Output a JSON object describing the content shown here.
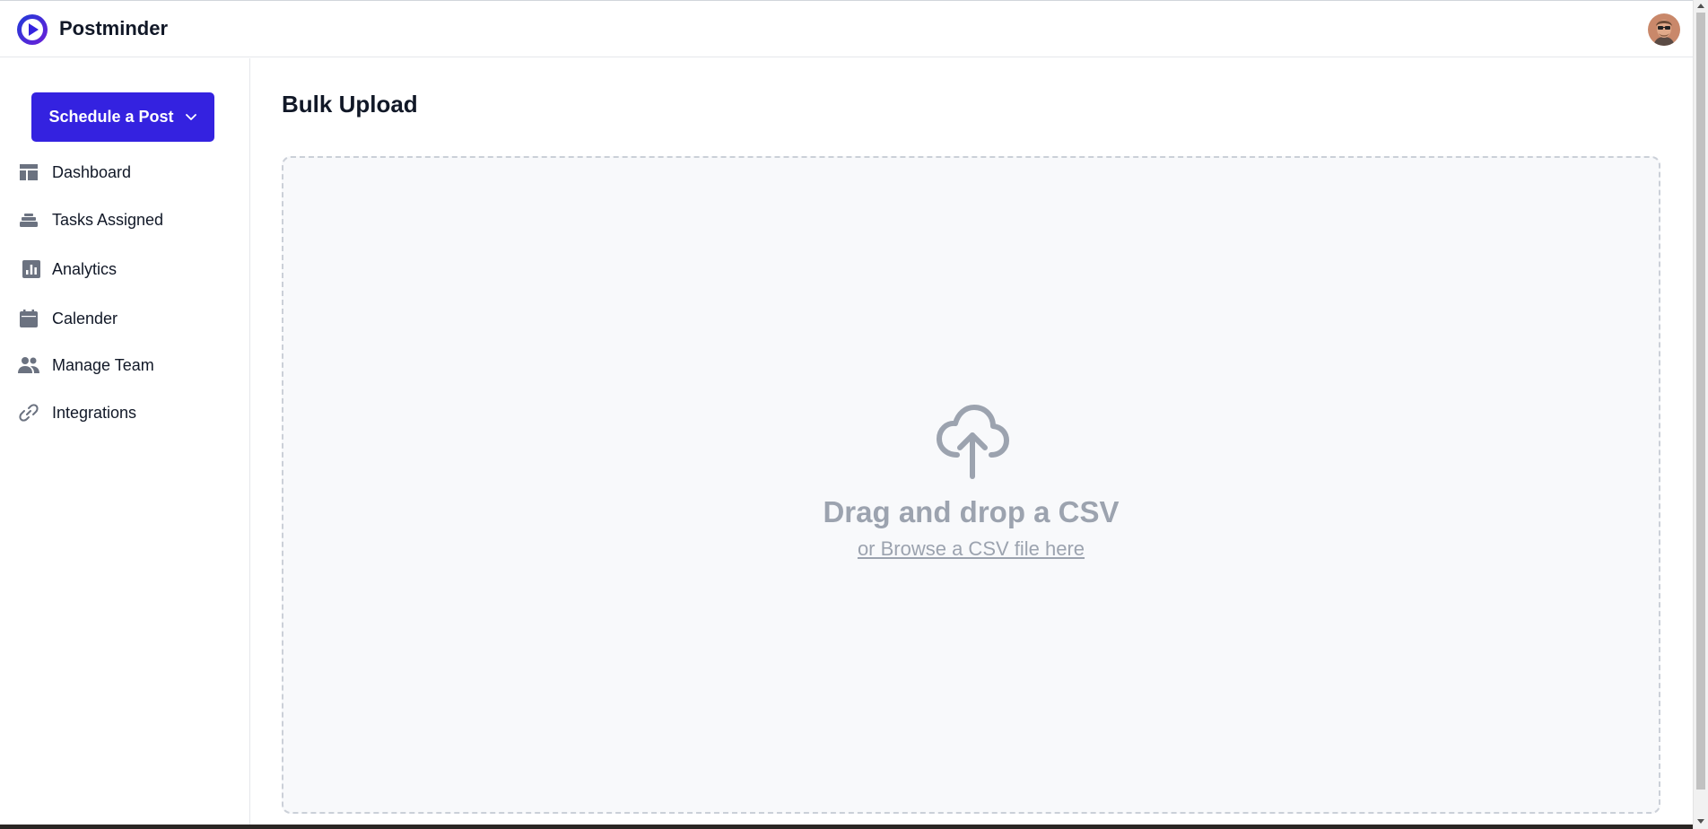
{
  "app": {
    "brand": "Postminder",
    "accent_color": "#3422e0"
  },
  "sidebar": {
    "schedule_button": "Schedule a Post",
    "items": [
      {
        "label": "Dashboard",
        "icon": "dashboard-icon"
      },
      {
        "label": "Tasks Assigned",
        "icon": "stack-icon"
      },
      {
        "label": "Analytics",
        "icon": "bar-chart-icon"
      },
      {
        "label": "Calender",
        "icon": "calendar-icon"
      },
      {
        "label": "Manage Team",
        "icon": "people-icon"
      },
      {
        "label": "Integrations",
        "icon": "link-icon"
      }
    ]
  },
  "main": {
    "title": "Bulk Upload",
    "dropzone": {
      "icon": "cloud-upload-icon",
      "title": "Drag and drop a CSV",
      "browse_text": "or Browse a CSV file here"
    }
  }
}
